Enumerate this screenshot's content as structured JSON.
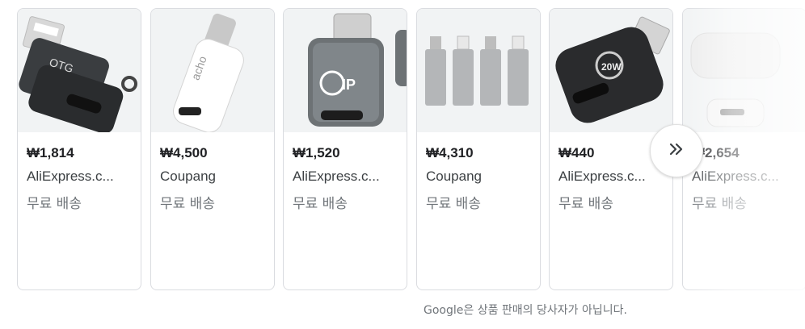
{
  "products": [
    {
      "price": "₩1,814",
      "store": "AliExpress.c...",
      "shipping": "무료 배송",
      "image": "black-otg-lightning-adapter"
    },
    {
      "price": "₩4,500",
      "store": "Coupang",
      "shipping": "무료 배송",
      "image": "white-usb-c-adapter"
    },
    {
      "price": "₩1,520",
      "store": "AliExpress.c...",
      "shipping": "무료 배송",
      "image": "gray-pd-usb-c-adapter"
    },
    {
      "price": "₩4,310",
      "store": "Coupang",
      "shipping": "무료 배송",
      "image": "four-silver-adapters"
    },
    {
      "price": "₩440",
      "store": "AliExpress.c...",
      "shipping": "무료 배송",
      "image": "black-20w-lightning-adapter"
    },
    {
      "price": "₩2,654",
      "store": "AliExpress.c...",
      "shipping": "무료 배송",
      "image": "white-cable-adapter"
    }
  ],
  "next_icon": "double-chevron-right-icon",
  "disclaimer": "Google은 상품 판매의 당사자가 아닙니다."
}
